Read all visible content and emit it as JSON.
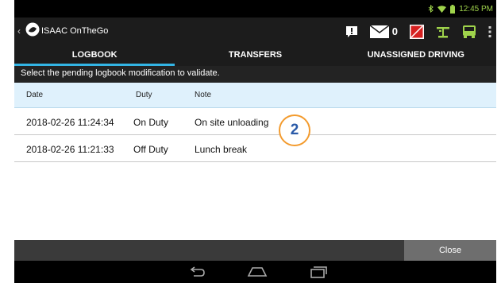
{
  "status": {
    "time": "12:45 PM"
  },
  "app": {
    "title": "ISAAC OnTheGo",
    "message_count": "0"
  },
  "tabs": [
    {
      "label": "LOGBOOK"
    },
    {
      "label": "TRANSFERS"
    },
    {
      "label": "UNASSIGNED DRIVING"
    }
  ],
  "subtitle": "Select the pending logbook modification to validate.",
  "table": {
    "headers": [
      "Date",
      "Duty",
      "Note"
    ],
    "rows": [
      {
        "date": "2018-02-26 11:24:34",
        "duty": "On Duty",
        "note": "On site unloading"
      },
      {
        "date": "2018-02-26 11:21:33",
        "duty": "Off Duty",
        "note": "Lunch break"
      }
    ]
  },
  "callout": "2",
  "footer": {
    "close_label": "Close"
  },
  "colors": {
    "accent": "#33b5e5",
    "status_icons": "#9fd34b",
    "header_bg": "#dff1fc",
    "callout_ring": "#f39b2e"
  },
  "icons": [
    "back-icon",
    "isaac-logo-icon",
    "alert-icon",
    "mail-icon",
    "notepad-icon",
    "signal-tower-icon",
    "truck-icon",
    "overflow-menu-icon",
    "nav-back-icon",
    "nav-home-icon",
    "nav-recents-icon"
  ]
}
